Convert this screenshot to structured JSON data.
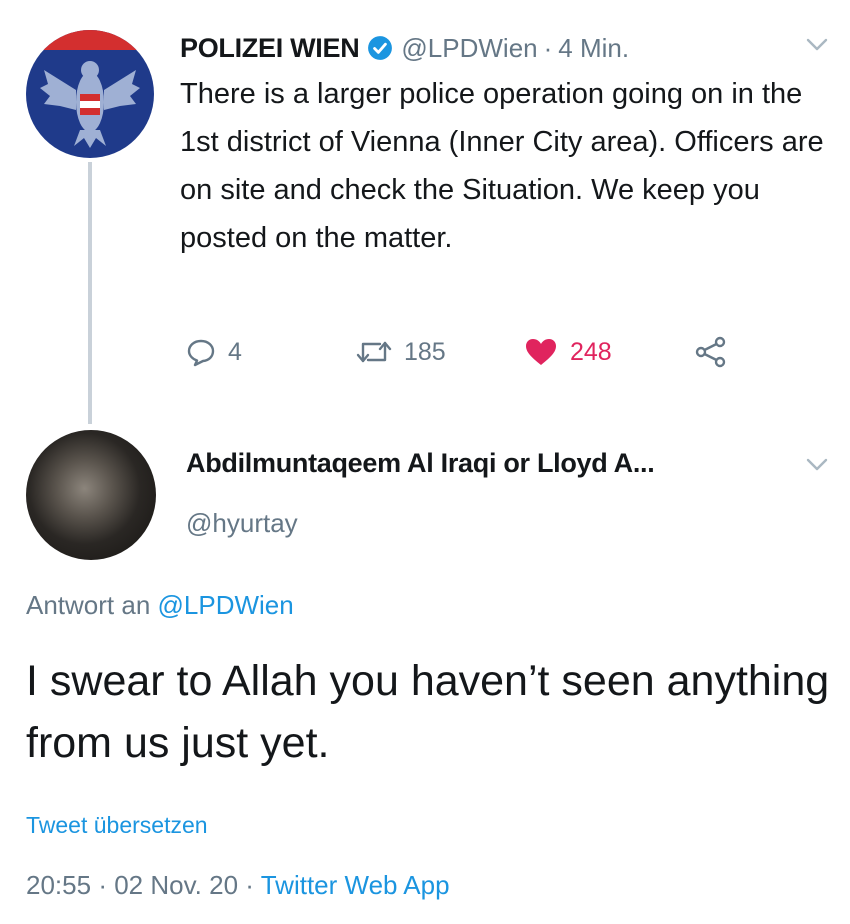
{
  "parent_tweet": {
    "author_name": "POLIZEI WIEN",
    "verified": true,
    "handle": "@LPDWien",
    "separator": "·",
    "time": "4 Min.",
    "text": "There is a larger police operation going on in the 1st district of Vienna (Inner City area). Officers are on site and check the Situation. We keep you posted on the matter.",
    "replies": "4",
    "retweets": "185",
    "likes": "248",
    "liked": true
  },
  "reply_tweet": {
    "author_name": "Abdilmuntaqeem Al Iraqi or Lloyd A...",
    "handle": "@hyurtay",
    "reply_prefix": "Antwort an ",
    "reply_mention": "@LPDWien",
    "text": "I swear to Allah you haven’t seen anything from us just yet.",
    "translate_label": "Tweet übersetzen",
    "time": "20:55",
    "separator": "·",
    "date": "02 Nov. 20",
    "app": "Twitter Web App"
  },
  "colors": {
    "link": "#1b95e0",
    "muted": "#657786",
    "like": "#e0245e",
    "police_blue": "#1f3a8a",
    "police_red": "#d32f2f"
  },
  "icons": [
    "verified-badge-icon",
    "chevron-down-icon",
    "reply-icon",
    "retweet-icon",
    "heart-icon",
    "share-icon",
    "eagle-crest-icon"
  ]
}
